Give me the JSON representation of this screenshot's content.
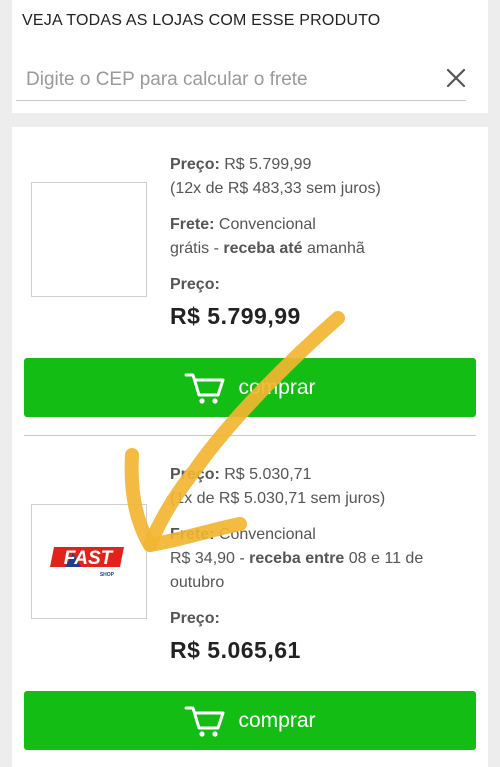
{
  "header": {
    "title": "VEJA TODAS AS LOJAS COM ESSE PRODUTO",
    "cep_placeholder": "Digite o CEP para calcular o frete"
  },
  "offers": [
    {
      "store": "",
      "price_label": "Preço:",
      "price_value": "R$ 5.799,99",
      "installments": "(12x de R$ 483,33 sem juros)",
      "shipping_label": "Frete:",
      "shipping_type": "Convencional",
      "shipping_cost": "grátis",
      "delivery_label": "receba até",
      "delivery_time": "amanhã",
      "total_label": "Preço:",
      "total_price": "R$  5.799,99",
      "button_label": "comprar"
    },
    {
      "store": "FAST SHOP",
      "logo_text": "FAST",
      "logo_sub": "SHOP",
      "price_label": "Preço:",
      "price_value": "R$ 5.030,71",
      "installments": "(1x de R$ 5.030,71 sem juros)",
      "shipping_label": "Frete:",
      "shipping_type": "Convencional",
      "shipping_cost": "R$ 34,90",
      "delivery_label": "receba entre",
      "delivery_time": "08 e 11 de",
      "delivery_time_2": "outubro",
      "total_label": "Preço:",
      "total_price": "R$  5.065,61",
      "button_label": "comprar"
    }
  ],
  "colors": {
    "buy_button": "#13bd13",
    "annotation_arrow": "#f2b531",
    "fastshop_red": "#e2231a",
    "fastshop_blue": "#1d3f8f"
  },
  "icons": {
    "close": "close-icon",
    "cart": "cart-icon"
  }
}
